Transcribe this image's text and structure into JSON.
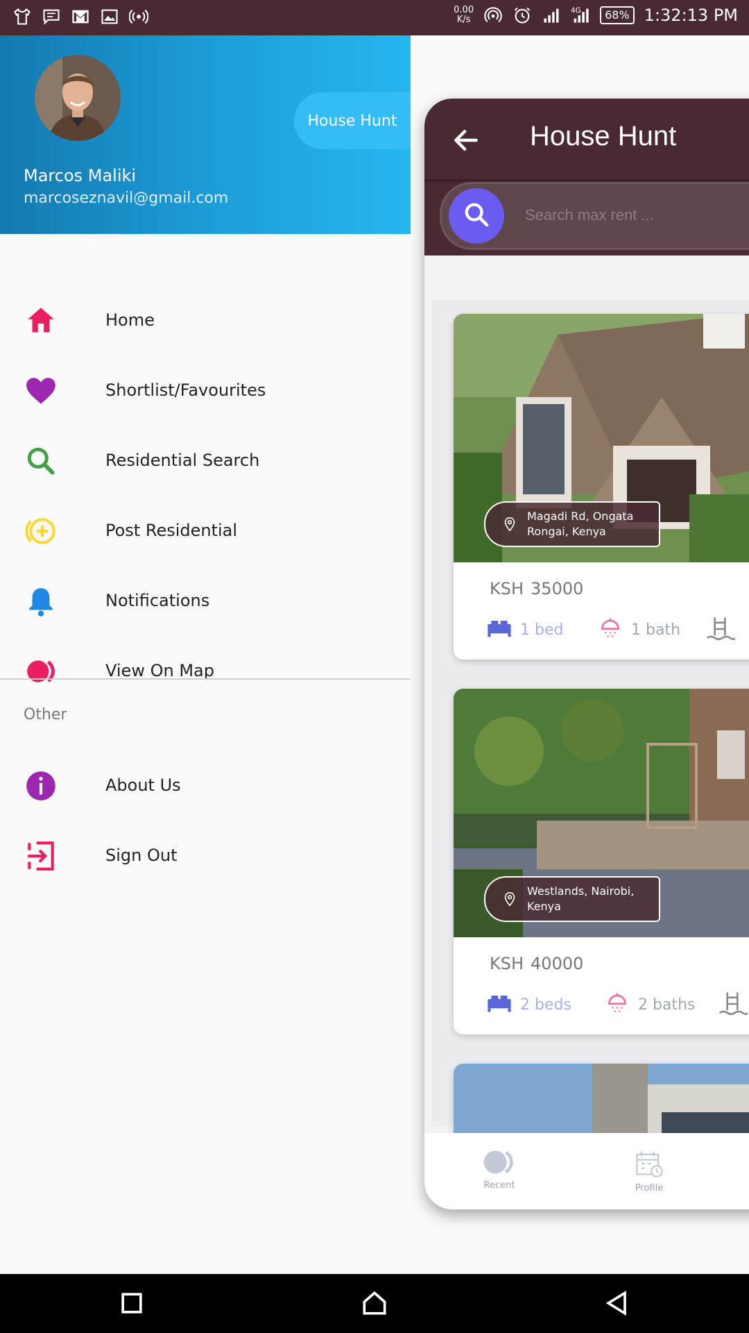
{
  "status_bar": {
    "net_speed": "0.00\nK/s",
    "net_speed_top": "0.00",
    "net_speed_bottom": "K/s",
    "network": "4G",
    "battery": "68%",
    "time": "1:32:13 PM"
  },
  "drawer": {
    "user_name": "Marcos Maliki",
    "user_email": "marcoseznavil@gmail.com",
    "app_pill": "House Hunt",
    "menu_items": [
      {
        "label": "Home",
        "icon": "home-icon",
        "color": "#e91e63"
      },
      {
        "label": "Shortlist/Favourites",
        "icon": "heart-icon",
        "color": "#9c27b0"
      },
      {
        "label": "Residential Search",
        "icon": "search-icon",
        "color": "#43a047"
      },
      {
        "label": "Post Residential",
        "icon": "add-circle-icon",
        "color": "#fdd835"
      },
      {
        "label": "Notifications",
        "icon": "bell-icon",
        "color": "#1e88e5"
      },
      {
        "label": "View On Map",
        "icon": "map-dots-icon",
        "color": "#e91e63"
      }
    ],
    "other_label": "Other",
    "other_items": [
      {
        "label": "About Us",
        "icon": "info-icon",
        "color": "#9c27b0"
      },
      {
        "label": "Sign Out",
        "icon": "sign-out-icon",
        "color": "#e91e63"
      }
    ]
  },
  "app": {
    "title": "House Hunt",
    "search_placeholder": "Search max rent ...",
    "header_color": "#4a2a32",
    "accent": "#6b5cf0",
    "listings": [
      {
        "location": "Magadi Rd, Ongata Rongai, Kenya",
        "location_line1": "Magadi Rd, Ongata",
        "location_line2": "Rongai, Kenya",
        "currency": "KSH",
        "price": "35000",
        "beds": "1 bed",
        "baths": "1 bath"
      },
      {
        "location": "Westlands, Nairobi, Kenya",
        "location_line1": "Westlands, Nairobi,",
        "location_line2": "Kenya",
        "currency": "KSH",
        "price": "40000",
        "beds": "2 beds",
        "baths": "2 baths"
      }
    ],
    "bottom_nav": [
      {
        "label": "Recent",
        "icon": "recent-icon"
      },
      {
        "label": "Profile",
        "icon": "calendar-icon"
      }
    ]
  }
}
